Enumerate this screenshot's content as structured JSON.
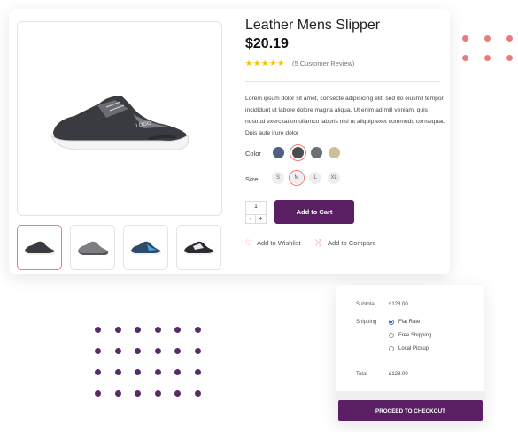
{
  "product": {
    "title": "Leather Mens Slipper",
    "price": "$20.19",
    "rating_stars": "★★★★★",
    "rating": 5,
    "review_text": "(5 Customer Review)",
    "description": "Lorem ipsum dolor sit amet, consecte adipisicing elit, sed do eiusmil tempor incididunt ut labore dolore magna aliqua. Ut enim ad mill veniam, quis nostrud exercitation ullamco laboris nisi ut aliquip exet commodo consequat. Duis aute irure dolor",
    "color_label": "Color",
    "colors": [
      "#4d5f82",
      "#4a4c52",
      "#6c6f74",
      "#cdbf98"
    ],
    "selected_color": 1,
    "size_label": "Size",
    "sizes": [
      "S",
      "M",
      "L",
      "XL"
    ],
    "selected_size": "M",
    "quantity": "1",
    "qty_minus": "-",
    "qty_plus": "+",
    "add_to_cart": "Add to Cart",
    "wishlist": "Add to Wishlist",
    "compare": "Add to Compare",
    "brand_text": "LOGO"
  },
  "cart": {
    "subtotal_label": "Subtotal",
    "subtotal_value": "£128.00",
    "shipping_label": "Shipping",
    "shipping_options": [
      "Flat Rate",
      "Free Shipping",
      "Local Pickup"
    ],
    "selected_shipping": 0,
    "total_label": "Total",
    "total_value": "£128.00",
    "checkout": "PROCEED TO CHECKOUT"
  },
  "colors": {
    "accent": "#5a1f63",
    "highlight": "#ee7b7b",
    "star": "#f2c200"
  }
}
